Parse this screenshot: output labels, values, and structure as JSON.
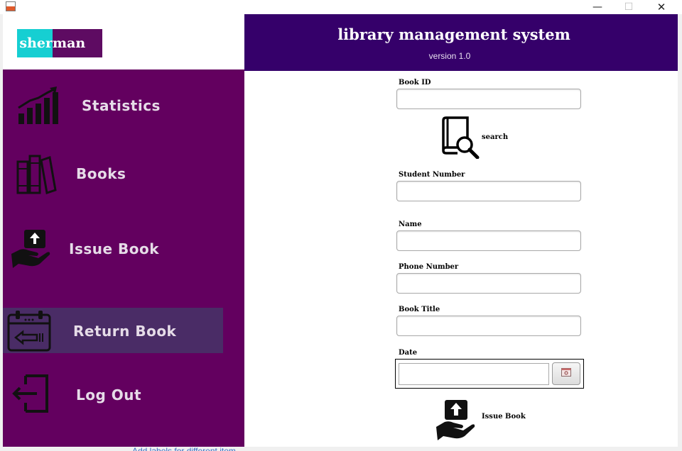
{
  "window": {
    "minimize_glyph": "—",
    "maximize_glyph": "☐",
    "close_glyph": "✕"
  },
  "logo": {
    "part1": "sher",
    "part2": "man",
    "color1": "#16cfd2",
    "color2": "#5e0b62"
  },
  "header": {
    "title": "library management system",
    "version": "version 1.0",
    "background": "#35006a"
  },
  "sidebar": {
    "background": "#63005f",
    "selected_background": "#4a2c66",
    "items": [
      {
        "label": "Statistics",
        "icon": "chart-icon"
      },
      {
        "label": "Books",
        "icon": "books-icon"
      },
      {
        "label": "Issue Book",
        "icon": "hand-upload-icon"
      },
      {
        "label": "Return Book",
        "icon": "calendar-return-icon",
        "selected": true
      },
      {
        "label": "Log Out",
        "icon": "logout-icon"
      }
    ]
  },
  "form": {
    "book_id_label": "Book ID",
    "book_id_value": "",
    "search_label": "search",
    "student_number_label": "Student Number",
    "student_number_value": "",
    "name_label": "Name",
    "name_value": "",
    "phone_label": "Phone Number",
    "phone_value": "",
    "book_title_label": "Book Title",
    "book_title_value": "",
    "date_label": "Date",
    "date_value": "",
    "issue_label": "Issue Book"
  },
  "background_text": "Add labels for different item"
}
